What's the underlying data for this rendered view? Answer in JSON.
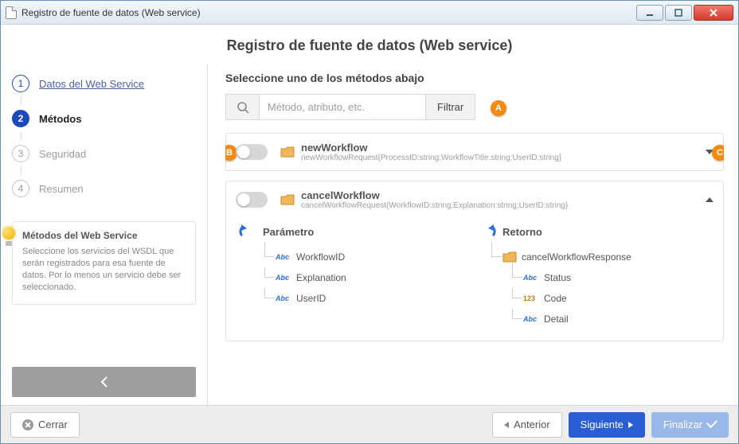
{
  "window": {
    "title": "Registro de fuente de datos (Web service)"
  },
  "page_title": "Registro de fuente de datos (Web service)",
  "sidebar": {
    "steps": [
      {
        "num": "1",
        "label": "Datos del Web Service",
        "state": "done"
      },
      {
        "num": "2",
        "label": "Métodos",
        "state": "active"
      },
      {
        "num": "3",
        "label": "Seguridad",
        "state": "pending"
      },
      {
        "num": "4",
        "label": "Resumen",
        "state": "pending"
      }
    ],
    "hint": {
      "title": "Métodos del Web Service",
      "desc": "Seleccione los servicios del WSDL que serán registrados para esa fuente de datos. Por lo menos un servicio debe ser seleccionado."
    }
  },
  "content": {
    "heading": "Seleccione uno de los métodos abajo",
    "search": {
      "placeholder": "Método, atributo, etc."
    },
    "filter_label": "Filtrar",
    "callouts": {
      "a": "A",
      "b": "B",
      "c": "C"
    },
    "methods": [
      {
        "name": "newWorkflow",
        "signature": "newWorkflowRequest{ProcessID:string;WorkflowTitle:string;UserID:string}",
        "expanded": false
      },
      {
        "name": "cancelWorkflow",
        "signature": "cancelWorkflowRequest{WorkflowID:string;Explanation:string;UserID:string}",
        "expanded": true,
        "param_header": "Parámetro",
        "return_header": "Retorno",
        "params": [
          {
            "type": "abc",
            "name": "WorkflowID"
          },
          {
            "type": "abc",
            "name": "Explanation"
          },
          {
            "type": "abc",
            "name": "UserID"
          }
        ],
        "returns_root": "cancelWorkflowResponse",
        "returns": [
          {
            "type": "abc",
            "name": "Status"
          },
          {
            "type": "123",
            "name": "Code"
          },
          {
            "type": "abc",
            "name": "Detail"
          }
        ]
      }
    ]
  },
  "footer": {
    "close": "Cerrar",
    "prev": "Anterior",
    "next": "Siguiente",
    "finish": "Finalizar"
  }
}
